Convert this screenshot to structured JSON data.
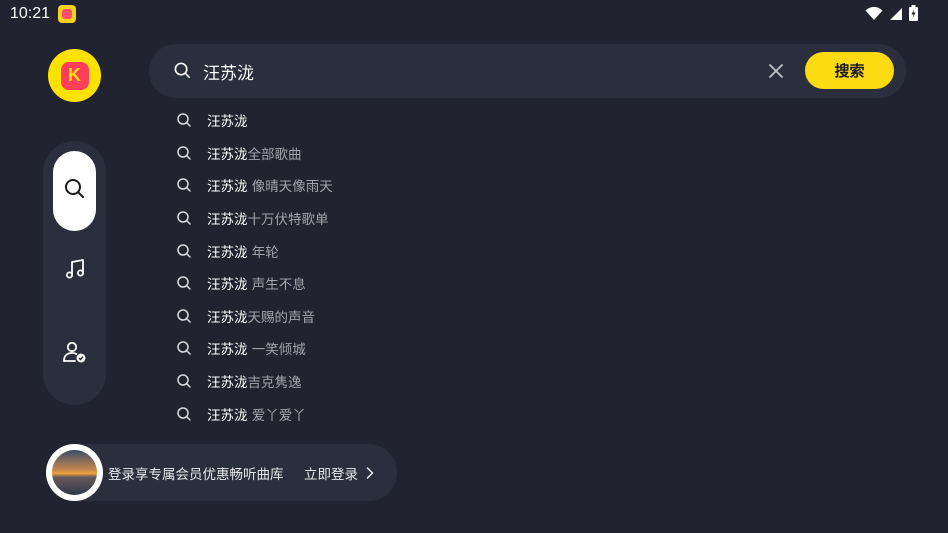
{
  "status_bar": {
    "time": "10:21",
    "icons": [
      "app-notification-icon",
      "wifi-icon",
      "signal-icon",
      "battery-icon"
    ]
  },
  "colors": {
    "background": "#212330",
    "panel": "#2b2e3c",
    "accent": "#fddb12",
    "secondary_text": "#a2a4ad"
  },
  "sidebar": {
    "items": [
      {
        "icon": "search-icon",
        "active": true
      },
      {
        "icon": "music-note-icon",
        "active": false
      },
      {
        "icon": "user-settings-icon",
        "active": false
      }
    ]
  },
  "search": {
    "value": "汪苏泷",
    "button_label": "搜索"
  },
  "suggestions": [
    {
      "keyword": "汪苏泷",
      "rest": ""
    },
    {
      "keyword": "汪苏泷",
      "rest": "全部歌曲"
    },
    {
      "keyword": "汪苏泷",
      "rest": " 像晴天像雨天"
    },
    {
      "keyword": "汪苏泷",
      "rest": "十万伏特歌单"
    },
    {
      "keyword": "汪苏泷",
      "rest": " 年轮"
    },
    {
      "keyword": "汪苏泷",
      "rest": " 声生不息"
    },
    {
      "keyword": "汪苏泷",
      "rest": "天赐的声音"
    },
    {
      "keyword": "汪苏泷",
      "rest": " 一笑倾城"
    },
    {
      "keyword": "汪苏泷",
      "rest": "吉克隽逸"
    },
    {
      "keyword": "汪苏泷",
      "rest": " 爱丫爱丫"
    }
  ],
  "login": {
    "promo_text": "登录享专属会员优惠畅听曲库",
    "link_label": "立即登录"
  }
}
